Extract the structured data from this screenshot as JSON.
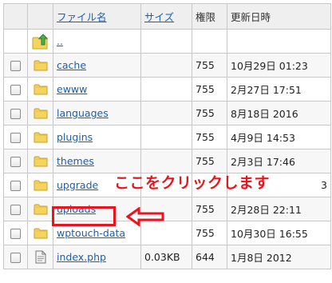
{
  "header": {
    "name_label": "ファイル名",
    "size_label": "サイズ",
    "perm_label": "権限",
    "date_label": "更新日時"
  },
  "rows": [
    {
      "icon": "up-folder-icon",
      "name": "..",
      "size": "",
      "perm": "",
      "date": "",
      "checkbox": false
    },
    {
      "icon": "folder-icon",
      "name": "cache",
      "size": "",
      "perm": "755",
      "date": "10月29日 01:23",
      "checkbox": true
    },
    {
      "icon": "folder-icon",
      "name": "ewww",
      "size": "",
      "perm": "755",
      "date": "2月27日 17:51",
      "checkbox": true
    },
    {
      "icon": "folder-icon",
      "name": "languages",
      "size": "",
      "perm": "755",
      "date": "8月18日 2016",
      "checkbox": true
    },
    {
      "icon": "folder-icon",
      "name": "plugins",
      "size": "",
      "perm": "755",
      "date": "4月9日 14:53",
      "checkbox": true
    },
    {
      "icon": "folder-icon",
      "name": "themes",
      "size": "",
      "perm": "755",
      "date": "2月3日 17:46",
      "checkbox": true
    },
    {
      "icon": "folder-icon",
      "name": "upgrade",
      "size": "",
      "perm": "",
      "date": "3",
      "checkbox": true
    },
    {
      "icon": "folder-icon",
      "name": "uploads",
      "size": "",
      "perm": "755",
      "date": "2月28日 22:11",
      "checkbox": true
    },
    {
      "icon": "folder-icon",
      "name": "wptouch-data",
      "size": "",
      "perm": "755",
      "date": "10月30日 16:55",
      "checkbox": true
    },
    {
      "icon": "file-icon",
      "name": "index.php",
      "size": "0.03KB",
      "perm": "644",
      "date": "1月8日 2012",
      "checkbox": true
    }
  ],
  "annotation": {
    "text": "ここをクリックします",
    "color": "#e8141e"
  }
}
